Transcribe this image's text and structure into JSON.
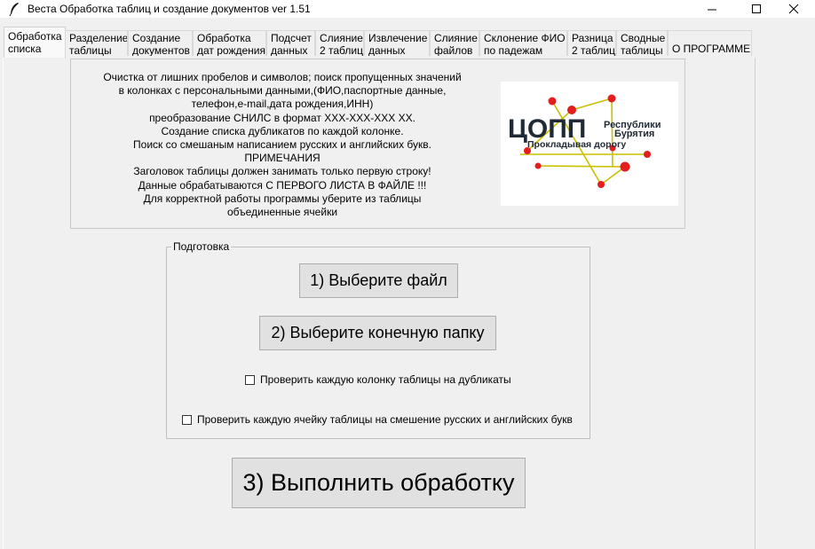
{
  "window": {
    "title": "Веста Обработка таблиц и создание документов ver 1.51",
    "icon": "feather-icon",
    "controls": [
      "minimize",
      "maximize",
      "close"
    ]
  },
  "tabs": [
    {
      "label": "Обработка\nсписка",
      "active": true
    },
    {
      "label": "Разделение\nтаблицы",
      "active": false
    },
    {
      "label": "Создание\nдокументов",
      "active": false
    },
    {
      "label": "Обработка\nдат рождения",
      "active": false
    },
    {
      "label": "Подсчет\nданных",
      "active": false
    },
    {
      "label": "Слияние\n2 таблиц",
      "active": false
    },
    {
      "label": "Извлечение\nданных",
      "active": false
    },
    {
      "label": "Слияние\nфайлов",
      "active": false
    },
    {
      "label": "Склонение ФИО\nпо падежам",
      "active": false
    },
    {
      "label": "Разница\n2 таблиц",
      "active": false
    },
    {
      "label": "Сводные\nтаблицы",
      "active": false
    },
    {
      "label": "О ПРОГРАММЕ",
      "active": false
    }
  ],
  "description": {
    "lines": [
      "Очистка от лишних пробелов и символов; поиск пропущенных значений",
      "в колонках с персональными данными,(ФИО,паспортные данные,",
      "телефон,e-mail,дата рождения,ИНН)",
      "преобразование СНИЛС в формат XXX-XXX-XXX XX.",
      "Создание списка дубликатов по каждой колонке.",
      "Поиск со смешаным написанием русских и английских букв.",
      "ПРИМЕЧАНИЯ",
      "Заголовок таблицы должен занимать только первую строку!",
      "Данные обрабатываются С ПЕРВОГО ЛИСТА В ФАЙЛЕ !!!",
      "Для корректной работы программы уберите из таблицы",
      "объединенные ячейки"
    ]
  },
  "logo": {
    "big_text": "ЦОПП",
    "small_line1": "Республики",
    "small_line2": "Бурятия",
    "tagline": "Прокладывая дорогу",
    "colors": {
      "text": "#1f2a36",
      "lines": "#c9c000",
      "dots": "#e41e1e"
    }
  },
  "prep": {
    "legend": "Подготовка",
    "select_file": "1) Выберите файл",
    "select_folder": "2) Выберите конечную папку",
    "check_duplicates": {
      "label": "Проверить каждую колонку таблицы на дубликаты",
      "checked": false
    },
    "check_mixed": {
      "label": "Проверить каждую ячейку таблицы на смешение русских и английских букв",
      "checked": false
    }
  },
  "run_label": "3) Выполнить обработку"
}
